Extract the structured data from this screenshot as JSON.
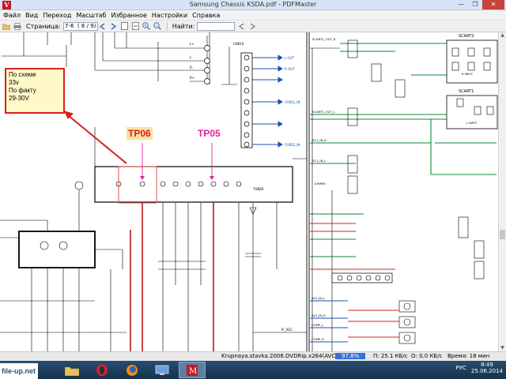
{
  "window": {
    "title": "Samsung Chassis KSDA.pdf - PDFMaster",
    "app_icon_letter": "V",
    "minimize": "—",
    "maximize": "❐",
    "close": "✕"
  },
  "menu": [
    "Файл",
    "Вид",
    "Переход",
    "Масштаб",
    "Избранное",
    "Настройки",
    "Справка"
  ],
  "toolbar": {
    "page_label": "Страница:",
    "page_value": "7-6  ( 6 / 9)",
    "find_label": "Найти:",
    "find_value": ""
  },
  "annotation": {
    "lines": [
      "По схеме",
      "33v",
      "По факту",
      "29-30V"
    ],
    "border_color": "#d42020",
    "fill_color": "#fff9c7"
  },
  "test_points": {
    "tp06": "TP06",
    "tp05": "TP05",
    "tp06_color": "#d42020",
    "tp05_color": "#e0209a"
  },
  "schematic_labels": {
    "scart2": "SCART2",
    "scart1": "SCART1",
    "scart1_out_r": "SCART1_OUT_R",
    "scart1_out_l": "SCART1_OUT_L",
    "scart_in_r": "SC1_IN_R",
    "scart_in_l": "SC1_IN_L",
    "comp_l": "COMP_L",
    "comp_r": "COMP_R",
    "av1_in_l": "AV1_IN_L",
    "av1_in_r": "AV1_IN_R",
    "cvbs1": "CVBS1_IN",
    "cvbs2": "CVBS2_IN",
    "audio_out_l": "L OUT",
    "audio_out_r": "R OUT",
    "r_input": "R INPUT",
    "l_input": "L INPUT",
    "jumper": "JUMPER",
    "cn910": "CN910",
    "if_agc": "IF_AGC",
    "tuner": "TUNER"
  },
  "status": {
    "file": "Krupnaya.stavka.2006.DVDRip.x264(AVC)",
    "progress": "97.8%",
    "download": "П: 25.1 КБ/с",
    "upload": "О: 0.0 КБ/с",
    "time": "Время: 18 мин"
  },
  "taskbar": {
    "lang": "РУС",
    "time": "8:49",
    "date": "25.06.2014",
    "watermark": "file-up.net"
  }
}
